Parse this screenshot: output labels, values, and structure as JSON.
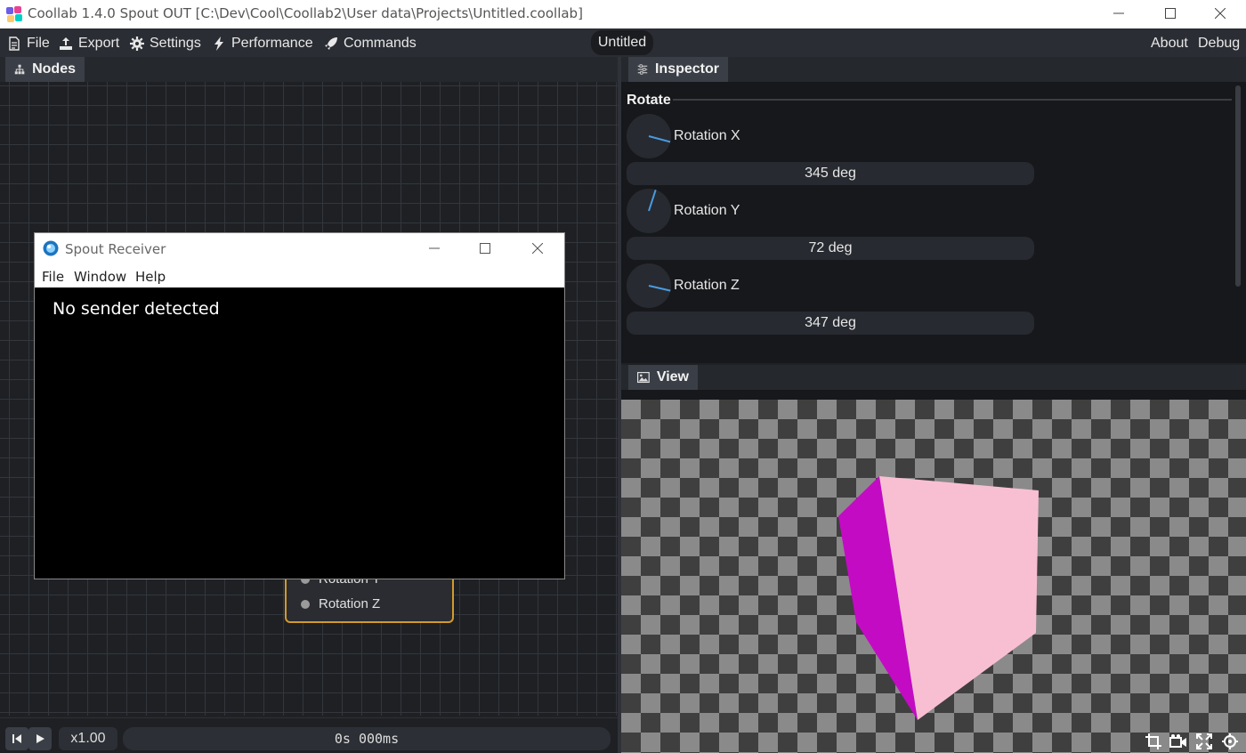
{
  "titlebar": {
    "title": "Coollab 1.4.0 Spout OUT [C:\\Dev\\Cool\\Coollab2\\User data\\Projects\\Untitled.coollab]"
  },
  "menubar": {
    "items": [
      {
        "label": "File",
        "icon": "document-icon"
      },
      {
        "label": "Export",
        "icon": "export-icon"
      },
      {
        "label": "Settings",
        "icon": "gear-icon"
      },
      {
        "label": "Performance",
        "icon": "bolt-icon"
      },
      {
        "label": "Commands",
        "icon": "rocket-icon"
      }
    ],
    "project_name": "Untitled",
    "about": "About",
    "debug": "Debug"
  },
  "nodes_panel": {
    "tab_label": "Nodes",
    "node_ports": [
      "Rotation Y",
      "Rotation Z"
    ]
  },
  "spout_window": {
    "title": "Spout Receiver",
    "menu": [
      "File",
      "Window",
      "Help"
    ],
    "message": "No sender detected"
  },
  "timeline": {
    "speed": "x1.00",
    "time": "0s 000ms"
  },
  "inspector": {
    "tab_label": "Inspector",
    "section": "Rotate",
    "params": [
      {
        "label": "Rotation X",
        "value": "345 deg",
        "angle_deg": 345
      },
      {
        "label": "Rotation Y",
        "value": "72 deg",
        "angle_deg": 72
      },
      {
        "label": "Rotation Z",
        "value": "347 deg",
        "angle_deg": 347
      }
    ]
  },
  "view": {
    "tab_label": "View",
    "tools": [
      "crop-icon",
      "camera-icon",
      "fullscreen-icon",
      "target-icon"
    ],
    "colors": {
      "cube_front": "#f8bfd3",
      "cube_side": "#c40bc4",
      "accent": "#d19a2e",
      "knob_line": "#4a9be0"
    }
  }
}
